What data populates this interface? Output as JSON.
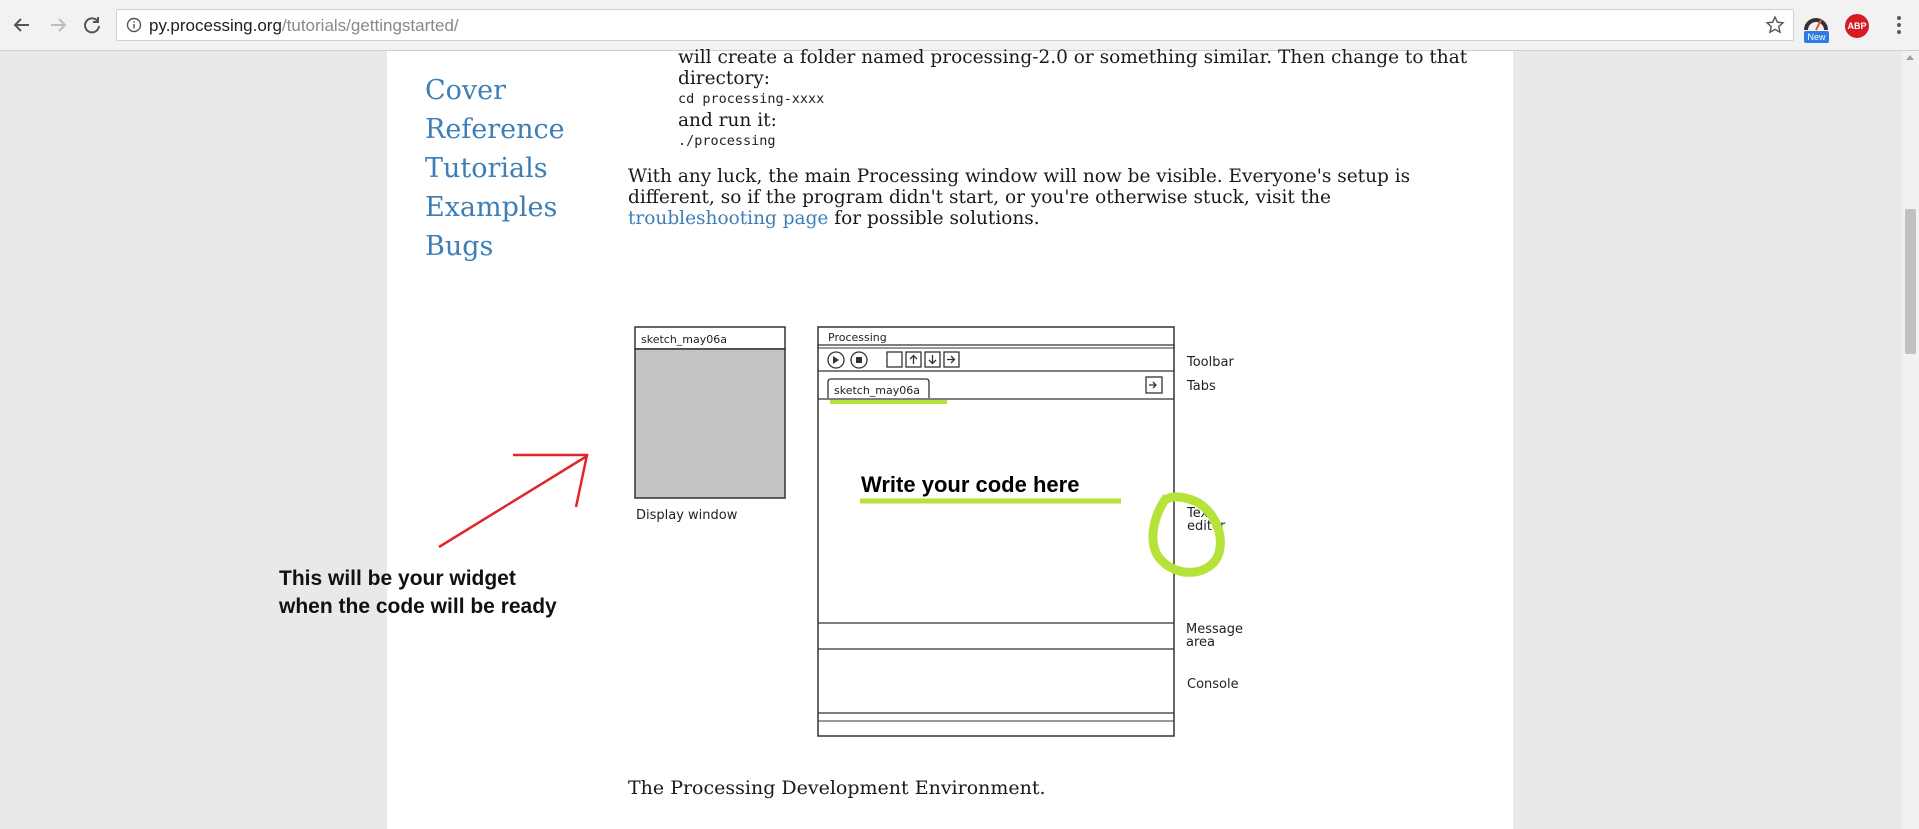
{
  "browser": {
    "url_host": "py.processing.org",
    "url_path": "/tutorials/gettingstarted/",
    "extension_badge": "New",
    "adblock_label": "ABP"
  },
  "sidebar": {
    "items": [
      {
        "label": "Cover"
      },
      {
        "label": "Reference"
      },
      {
        "label": "Tutorials"
      },
      {
        "label": "Examples"
      },
      {
        "label": "Bugs"
      }
    ]
  },
  "content": {
    "intro_line1": "will create a folder named processing-2.0 or something similar. Then change to that",
    "intro_line2": "directory:",
    "cmd_cd": "cd processing-xxxx",
    "run_text": "and run it:",
    "cmd_run": "./processing",
    "para_1": "With any luck, the main Processing window will now be visible. Everyone's setup is",
    "para_2": "different, so if the program didn't start, or you're otherwise stuck, visit the",
    "link_text": "troubleshooting page",
    "para_3": " for possible solutions.",
    "caption": "The Processing Development Environment."
  },
  "diagram": {
    "display_title": "sketch_may06a",
    "display_label": "Display window",
    "ide_title": "Processing",
    "tab_label": "sketch_may06a",
    "label_toolbar": "Toolbar",
    "label_tabs": "Tabs",
    "label_text_editor_1": "Text",
    "label_text_editor_2": "editor",
    "label_message_1": "Message",
    "label_message_2": "area",
    "label_console": "Console"
  },
  "annotations": {
    "write_code": "Write your code here",
    "widget_line1": "This will be your widget",
    "widget_line2": "when the code will be ready",
    "highlight_color": "#b6e33a",
    "arrow_color": "#e0262a"
  }
}
